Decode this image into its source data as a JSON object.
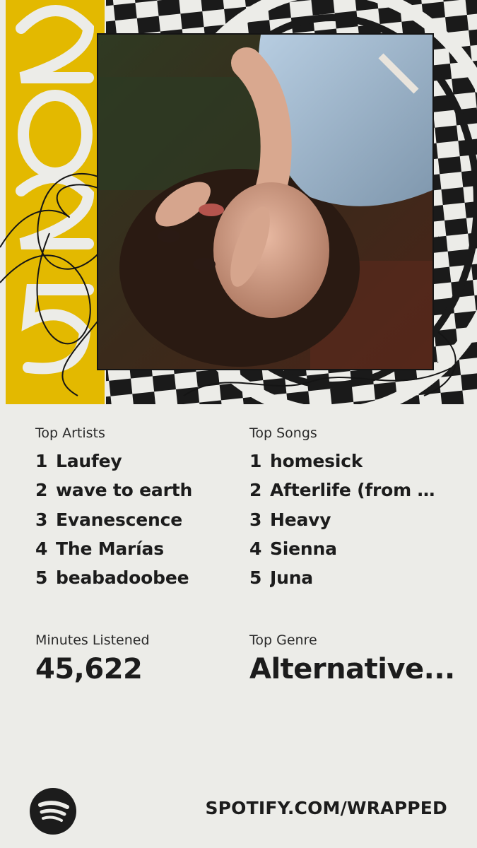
{
  "year_graphic": "2025",
  "colors": {
    "background": "#ecece8",
    "year_yellow": "#e3b900",
    "checker_dark": "#1a1a1a",
    "text": "#1c1c1c"
  },
  "hero": {
    "image_label": "artist-photo"
  },
  "top_artists": {
    "title": "Top Artists",
    "items": [
      {
        "rank": "1",
        "name": "Laufey"
      },
      {
        "rank": "2",
        "name": "wave to earth"
      },
      {
        "rank": "3",
        "name": "Evanescence"
      },
      {
        "rank": "4",
        "name": "The Marías"
      },
      {
        "rank": "5",
        "name": "beabadoobee"
      }
    ]
  },
  "top_songs": {
    "title": "Top Songs",
    "items": [
      {
        "rank": "1",
        "name": "homesick"
      },
      {
        "rank": "2",
        "name": "Afterlife (from t..."
      },
      {
        "rank": "3",
        "name": "Heavy"
      },
      {
        "rank": "4",
        "name": "Sienna"
      },
      {
        "rank": "5",
        "name": "Juna"
      }
    ]
  },
  "minutes": {
    "label": "Minutes Listened",
    "value": "45,622"
  },
  "genre": {
    "label": "Top Genre",
    "value": "Alternative..."
  },
  "footer": {
    "logo_icon": "spotify-logo-icon",
    "url": "SPOTIFY.COM/WRAPPED"
  }
}
